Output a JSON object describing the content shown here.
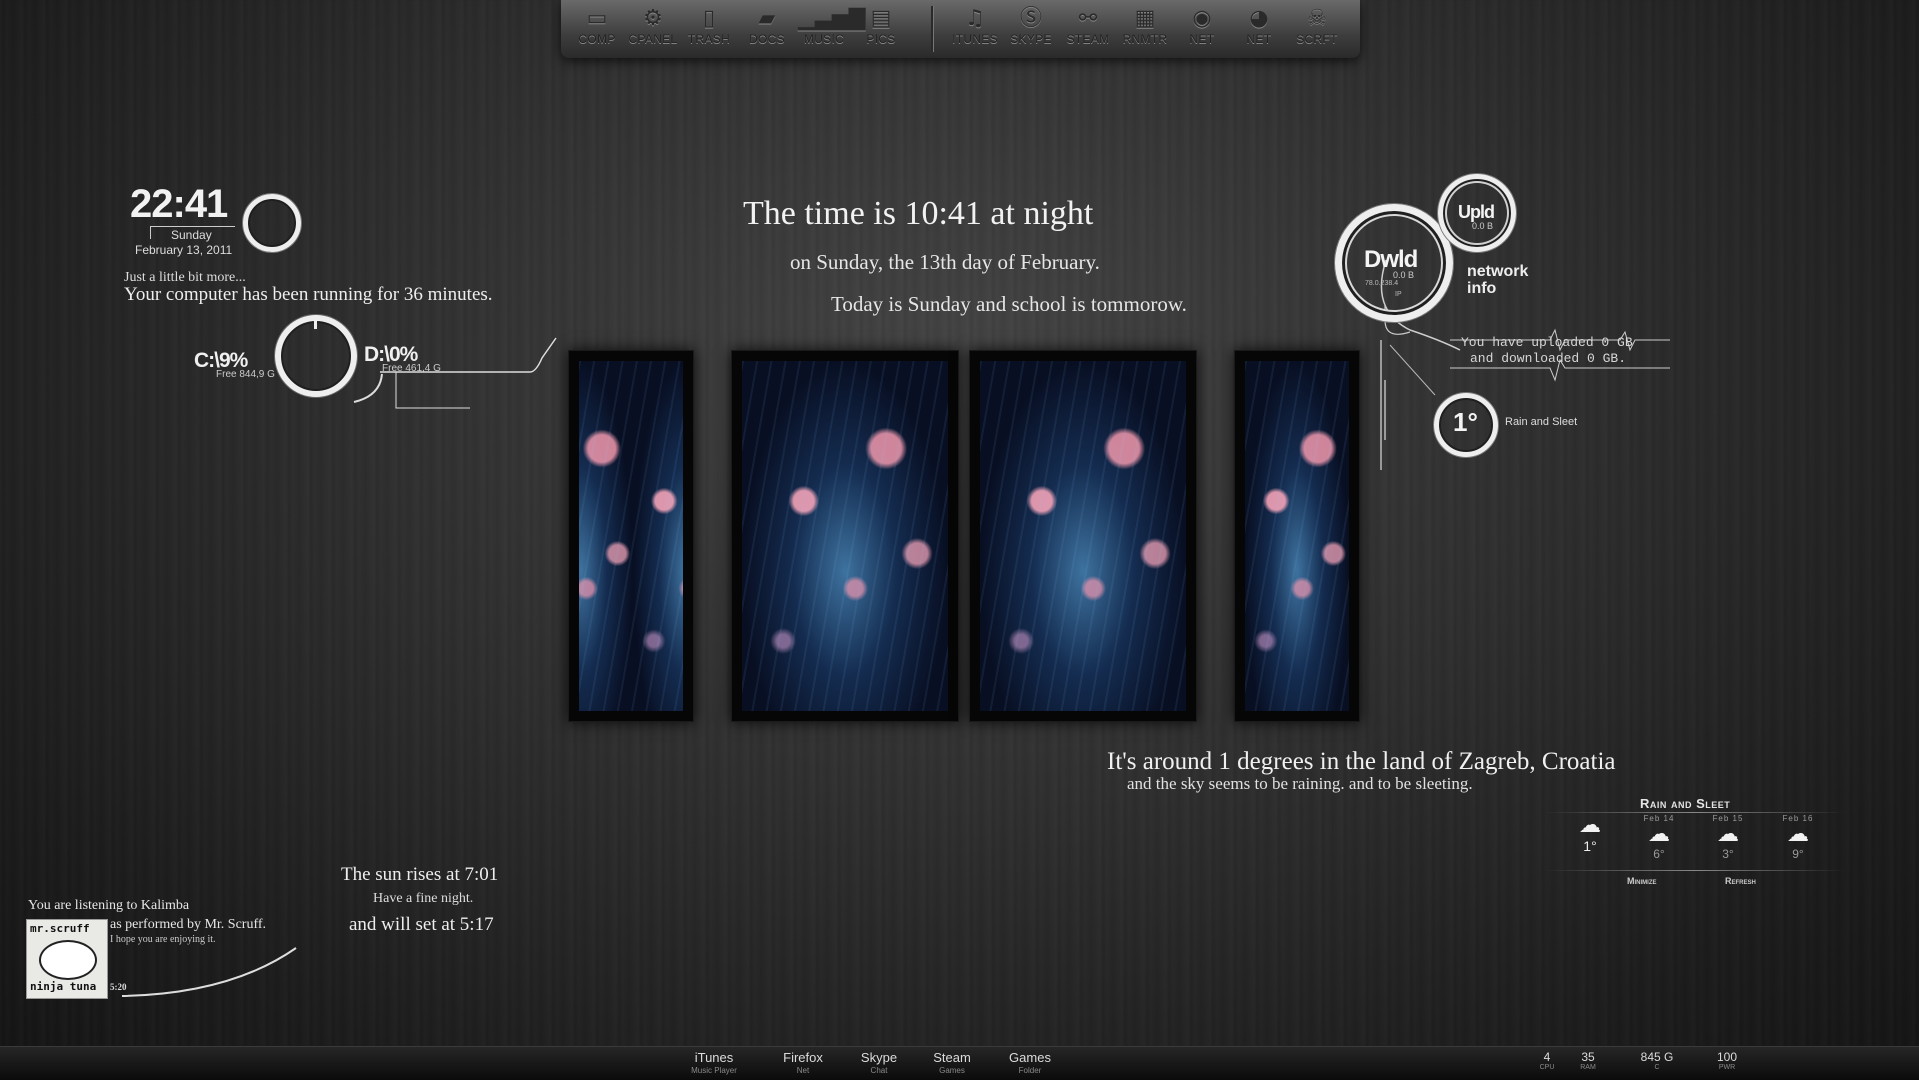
{
  "dock": {
    "items": [
      {
        "label": "COMP",
        "icon": "computer-icon"
      },
      {
        "label": "CPANEL",
        "icon": "gears-icon"
      },
      {
        "label": "TRASH",
        "icon": "trash-icon"
      },
      {
        "label": "DOCS",
        "icon": "folder-icon"
      },
      {
        "label": "MUSIC",
        "icon": "equalizer-icon"
      },
      {
        "label": "PICS",
        "icon": "photos-icon"
      },
      {
        "label": "ITUNES",
        "icon": "itunes-icon"
      },
      {
        "label": "SKYPE",
        "icon": "skype-icon"
      },
      {
        "label": "STEAM",
        "icon": "steam-icon"
      },
      {
        "label": "RNMTR",
        "icon": "rainmeter-icon"
      },
      {
        "label": "NET",
        "icon": "globe-icon"
      },
      {
        "label": "NET",
        "icon": "firefox-icon"
      },
      {
        "label": "SCRFT",
        "icon": "skull-icon"
      }
    ]
  },
  "clock": {
    "time": "22:41",
    "day": "Sunday",
    "date": "February 13, 2011",
    "note": "Just a little bit more...",
    "uptime": "Your computer has been running for 36 minutes."
  },
  "drives": {
    "c_label": "C:\\9%",
    "c_free": "Free 844,9 G",
    "d_label": "D:\\0%",
    "d_free": "Free 461,4 G",
    "c_used_fraction": 0.09,
    "d_used_fraction": 0.0
  },
  "sentence": {
    "line1": "The time is 10:41 at night",
    "line2": "on Sunday, the 13th day of February.",
    "line3": "Today is Sunday and school is tommorow."
  },
  "network": {
    "upload_label": "Upld",
    "upload_value": "0.0 B",
    "download_label": "Dwld",
    "download_value": "0.0 B",
    "ip": "78.0.238.4",
    "ip_label": "IP",
    "title_line1": "network",
    "title_line2": "info",
    "summary_line1": "You have uploaded 0 GB",
    "summary_line2": "and downloaded 0 GB."
  },
  "weather_ring": {
    "temp": "1°",
    "condition": "Rain and Sleet"
  },
  "weather_text": {
    "line1": "It's around 1 degrees in the land of Zagreb, Croatia",
    "line2": "and the sky seems to be raining. and to be sleeting."
  },
  "forecast": {
    "title": "Rain and Sleet",
    "days": [
      {
        "date": "",
        "temp": "1°",
        "icon": "snow-cloud-icon"
      },
      {
        "date": "Feb 14",
        "temp": "6°",
        "icon": "snow-cloud-icon"
      },
      {
        "date": "Feb 15",
        "temp": "3°",
        "icon": "snow-cloud-icon"
      },
      {
        "date": "Feb 16",
        "temp": "9°",
        "icon": "snow-cloud-icon"
      }
    ],
    "minimize": "Minimize",
    "refresh": "Refresh"
  },
  "sun": {
    "rise": "The sun rises at 7:01",
    "wish": "Have a fine night.",
    "set": "and will set at 5:17"
  },
  "music": {
    "line1": "You are listening to Kalimba",
    "line2": "as performed by Mr. Scruff.",
    "line3": "I hope you are enjoying it.",
    "time": "5:20",
    "album_top": "mr.scruff",
    "album_bottom": "ninja tuna"
  },
  "taskbar": {
    "apps": [
      {
        "label": "iTunes",
        "sub": "Music Player"
      },
      {
        "label": "Firefox",
        "sub": "Net"
      },
      {
        "label": "Skype",
        "sub": "Chat"
      },
      {
        "label": "Steam",
        "sub": "Games"
      },
      {
        "label": "Games",
        "sub": "Folder"
      }
    ],
    "stats": [
      {
        "value": "4",
        "label": "CPU"
      },
      {
        "value": "35",
        "label": "RAM"
      },
      {
        "value": "845 G",
        "label": "C"
      },
      {
        "value": "100",
        "label": "PWR"
      }
    ]
  }
}
